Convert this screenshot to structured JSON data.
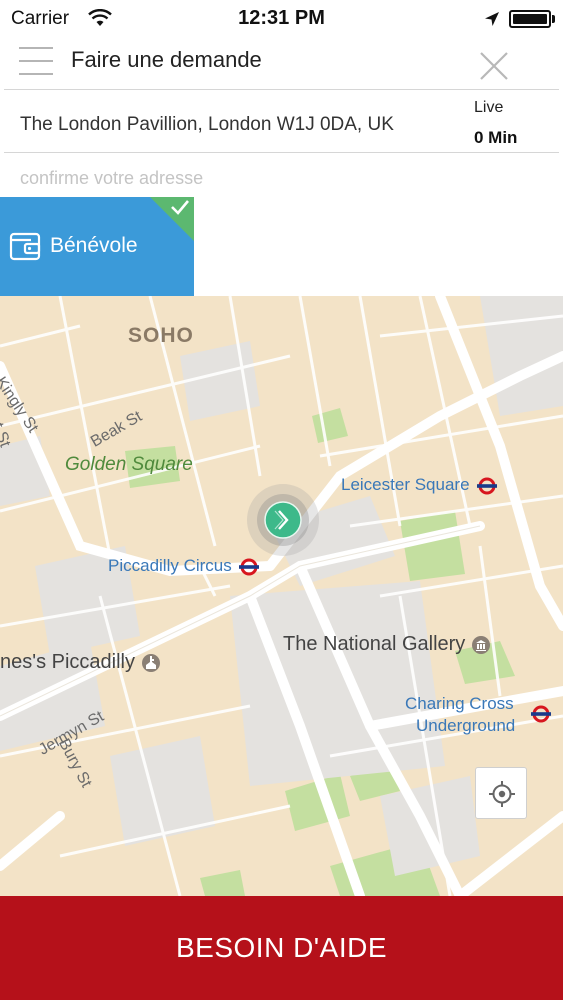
{
  "status_bar": {
    "carrier": "Carrier",
    "time": "12:31 PM"
  },
  "header": {
    "title": "Faire une demande"
  },
  "address": {
    "value": "The London Pavillion, London W1J 0DA, UK",
    "live_label": "Live",
    "eta": "0 Min"
  },
  "confirm_placeholder": "confirme votre adresse",
  "service_tile": {
    "label": "Bénévole",
    "selected": true
  },
  "map": {
    "labels": {
      "soho": "SOHO",
      "kingly_st": "Kingly St",
      "regent_st": "gent St",
      "beak_st": "Beak St",
      "golden_square": "Golden Square",
      "leicester_square": "Leicester Square",
      "piccadilly_circus": "Piccadilly Circus",
      "national_gallery": "The National Gallery",
      "st_james_piccadilly": "nes's Piccadilly",
      "jermyn_st": "Jermyn St",
      "bury_st": "Bury St",
      "charing_cross_1": "Charing Cross",
      "charing_cross_2": "Underground"
    }
  },
  "help_button": {
    "label": "BESOIN D'AIDE"
  },
  "colors": {
    "primary_red": "#b5111a",
    "tile_blue": "#3b9ad9",
    "check_green": "#5cb870",
    "pin_green": "#3db98a",
    "map_bg": "#f3e3c7"
  }
}
